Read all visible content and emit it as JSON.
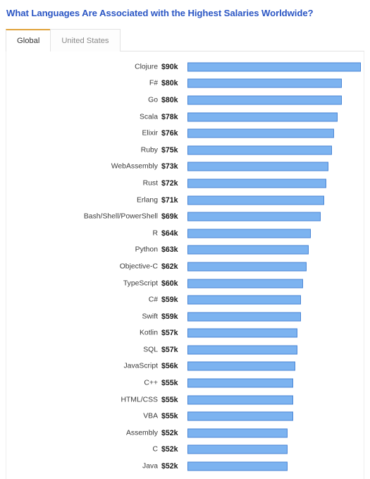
{
  "header": {
    "title": "What Languages Are Associated with the Highest Salaries Worldwide?",
    "title_color": "#2b56c4"
  },
  "tabs": {
    "active_accent_color": "#e0a33c",
    "items": [
      {
        "label": "Global",
        "active": true
      },
      {
        "label": "United States",
        "active": false
      }
    ]
  },
  "chart_data": {
    "type": "bar",
    "orientation": "horizontal",
    "title": "What Languages Are Associated with the Highest Salaries Worldwide?",
    "xlabel": "",
    "ylabel": "",
    "grid": false,
    "legend": false,
    "xlim": [
      0,
      90
    ],
    "value_unit": "k",
    "value_prefix": "$",
    "bar_fill_color": "#7cb3f0",
    "bar_border_color": "#4a86d6",
    "categories": [
      "Clojure",
      "F#",
      "Go",
      "Scala",
      "Elixir",
      "Ruby",
      "WebAssembly",
      "Rust",
      "Erlang",
      "Bash/Shell/PowerShell",
      "R",
      "Python",
      "Objective-C",
      "TypeScript",
      "C#",
      "Swift",
      "Kotlin",
      "SQL",
      "JavaScript",
      "C++",
      "HTML/CSS",
      "VBA",
      "Assembly",
      "C",
      "Java"
    ],
    "values": [
      90,
      80,
      80,
      78,
      76,
      75,
      73,
      72,
      71,
      69,
      64,
      63,
      62,
      60,
      59,
      59,
      57,
      57,
      56,
      55,
      55,
      55,
      52,
      52,
      52
    ],
    "value_labels": [
      "$90k",
      "$80k",
      "$80k",
      "$78k",
      "$76k",
      "$75k",
      "$73k",
      "$72k",
      "$71k",
      "$69k",
      "$64k",
      "$63k",
      "$62k",
      "$60k",
      "$59k",
      "$59k",
      "$57k",
      "$57k",
      "$56k",
      "$55k",
      "$55k",
      "$55k",
      "$52k",
      "$52k",
      "$52k"
    ]
  }
}
